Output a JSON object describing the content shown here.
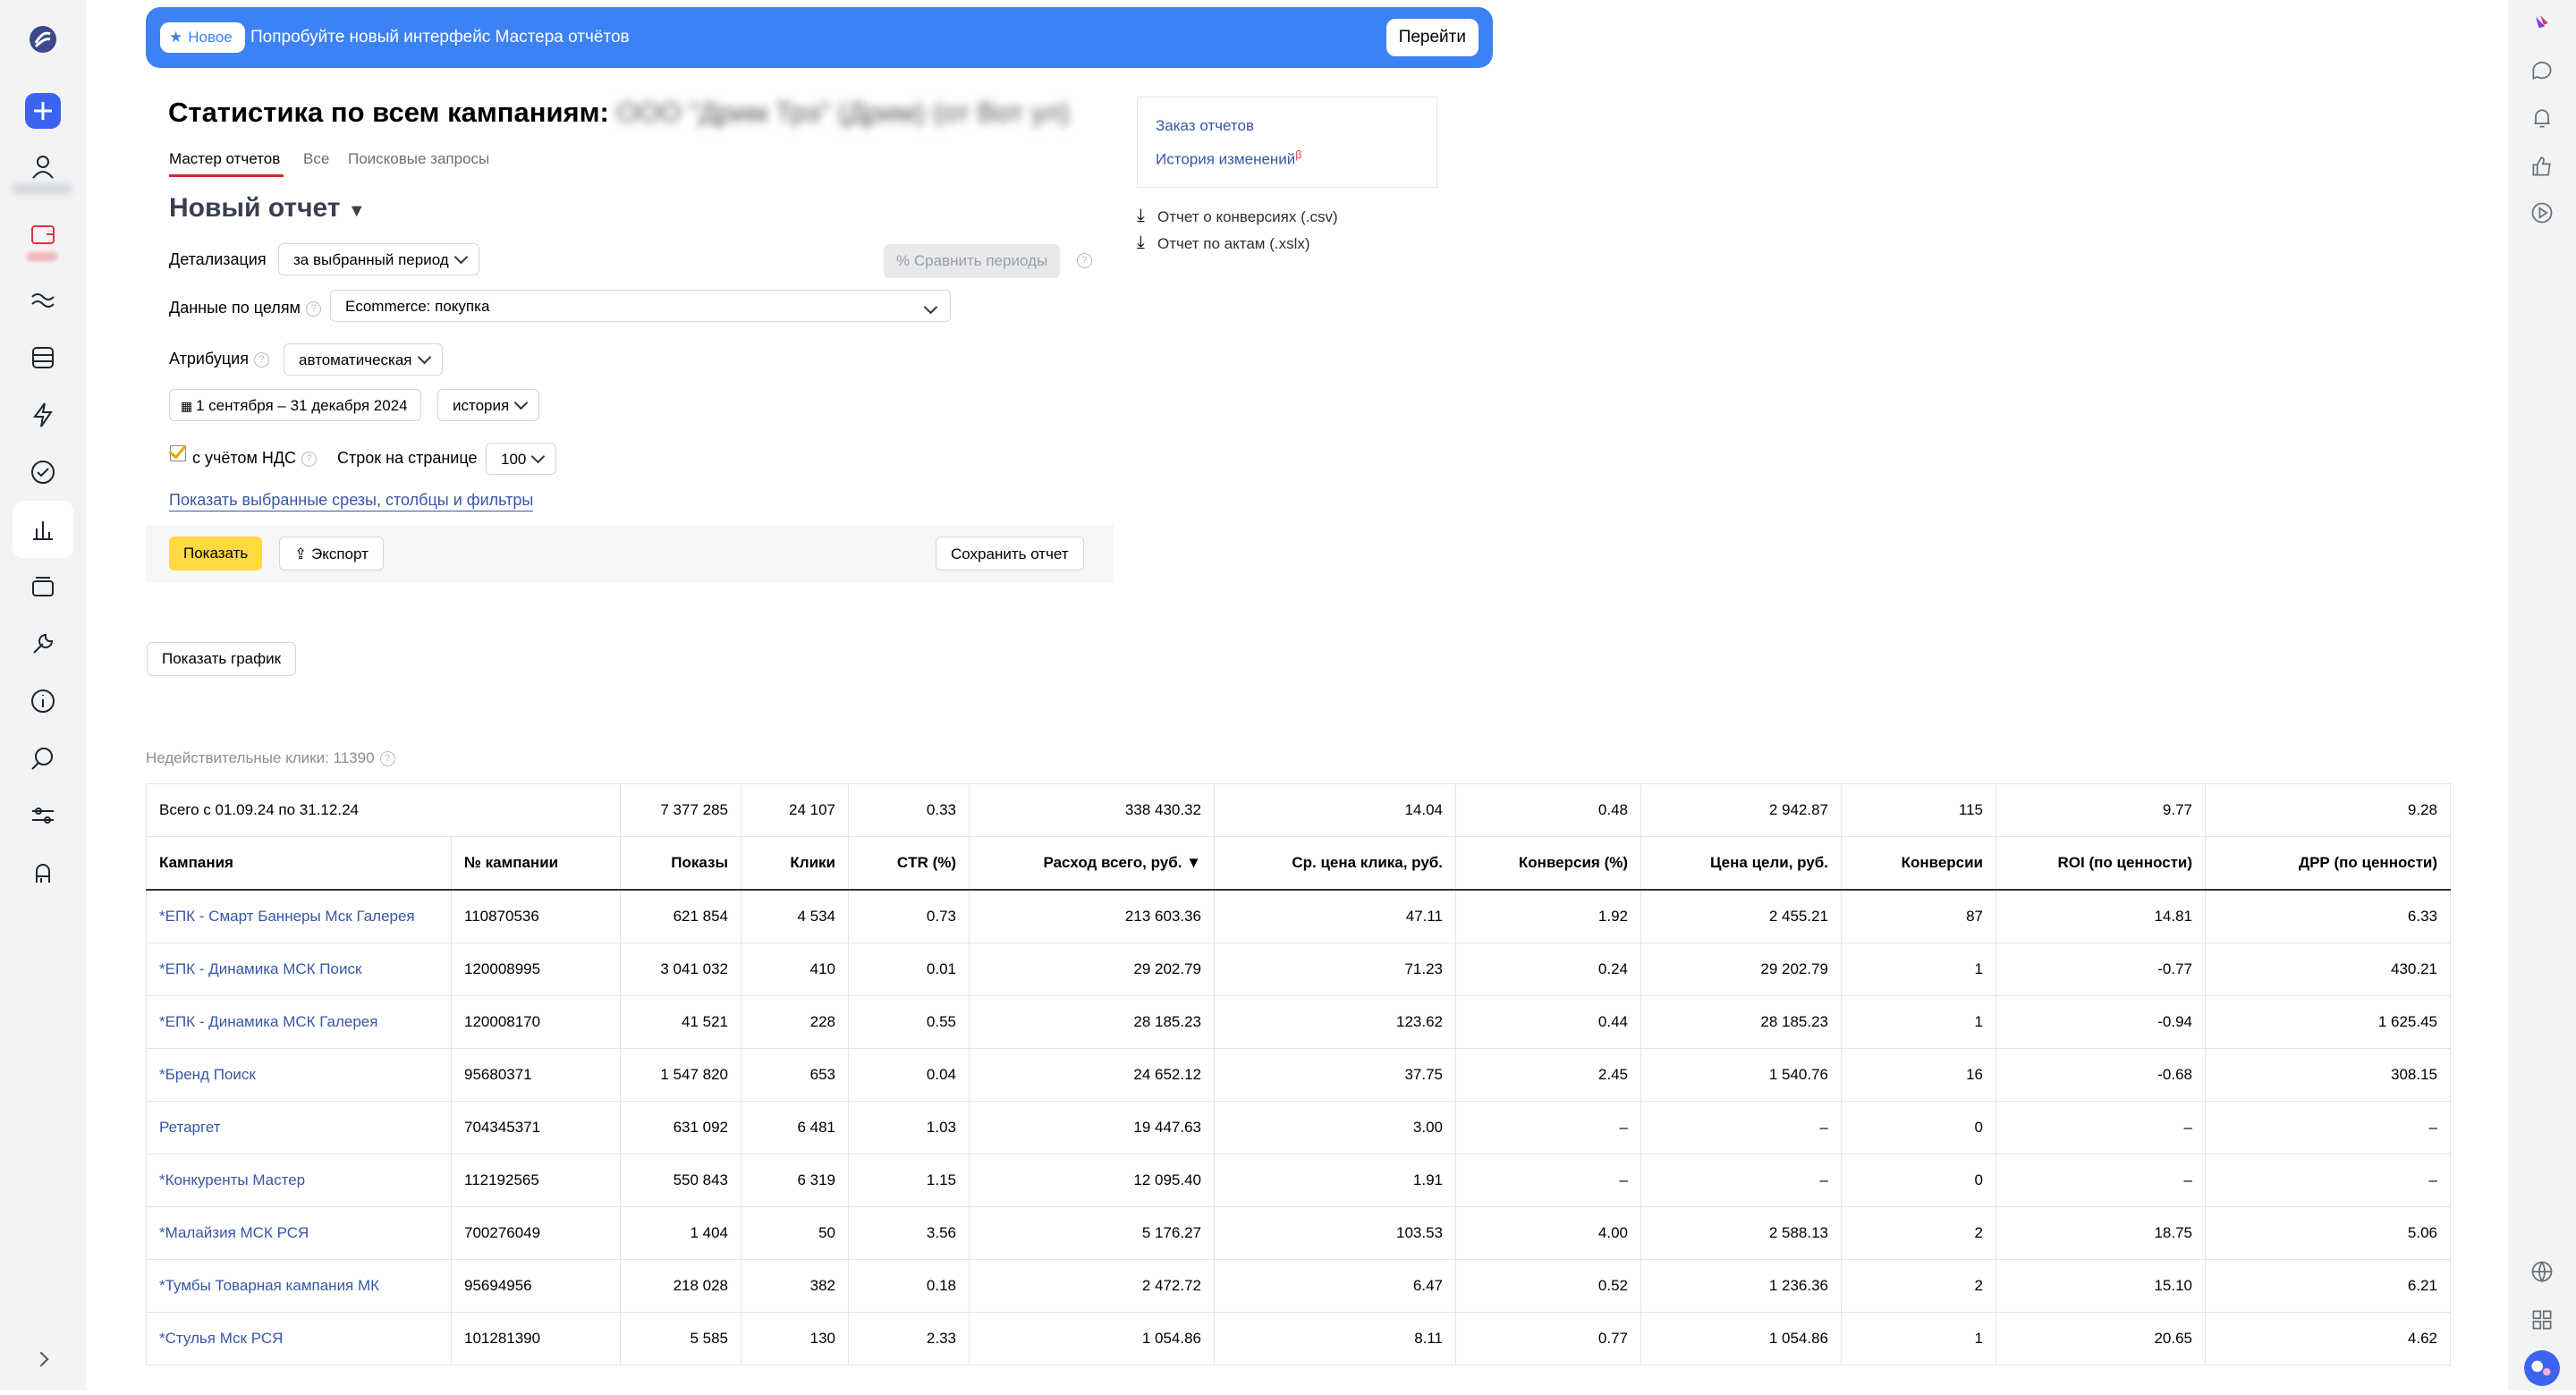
{
  "banner": {
    "badge": "Новое",
    "text": "Попробуйте новый интерфейс Мастера отчётов",
    "button": "Перейти"
  },
  "page": {
    "title": "Статистика по всем кампаниям:",
    "title_blurred": "ООО \"Дрим Трэ\" (Дрим) (от Вот ул)"
  },
  "tabs": [
    "Мастер отчетов",
    "Все",
    "Поисковые запросы"
  ],
  "report": {
    "name": "Новый отчет",
    "detail_label": "Детализация",
    "detail_value": "за выбранный период",
    "compare": "Сравнить периоды",
    "goals_label": "Данные по целям",
    "goals_value": "Ecommerce: покупка",
    "attribution_label": "Атрибуция",
    "attribution_value": "автоматическая",
    "date_range": "1 сентября – 31 декабря 2024",
    "history": "история",
    "vat_label": "с учётом НДС",
    "rows_label": "Строк на странице",
    "rows_value": "100",
    "filters_link": "Показать выбранные срезы, столбцы и фильтры",
    "show_button": "Показать",
    "export_button": "Экспорт",
    "save_button": "Сохранить отчет"
  },
  "side_links": {
    "order": "Заказ отчетов",
    "history": "История изменений",
    "history_sup": "β",
    "conversions": "Отчет о конверсиях (.csv)",
    "acts": "Отчет по актам (.xslx)"
  },
  "graph_button": "Показать график",
  "invalid_clicks": "Недействительные клики: 11390",
  "table": {
    "total": [
      "Всего с 01.09.24 по 31.12.24",
      "7 377 285",
      "24 107",
      "0.33",
      "338 430.32",
      "14.04",
      "0.48",
      "2 942.87",
      "115",
      "9.77",
      "9.28"
    ],
    "headers": [
      "Кампания",
      "№ кампании",
      "Показы",
      "Клики",
      "CTR (%)",
      "Расход всего, руб. ▼",
      "Ср. цена клика, руб.",
      "Конверсия (%)",
      "Цена цели, руб.",
      "Конверсии",
      "ROI (по ценности)",
      "ДРР (по ценности)"
    ],
    "rows": [
      [
        "*ЕПК - Смарт Баннеры Мск Галерея",
        "110870536",
        "621 854",
        "4 534",
        "0.73",
        "213 603.36",
        "47.11",
        "1.92",
        "2 455.21",
        "87",
        "14.81",
        "6.33"
      ],
      [
        "*ЕПК - Динамика МСК Поиск",
        "120008995",
        "3 041 032",
        "410",
        "0.01",
        "29 202.79",
        "71.23",
        "0.24",
        "29 202.79",
        "1",
        "-0.77",
        "430.21"
      ],
      [
        "*ЕПК - Динамика МСК Галерея",
        "120008170",
        "41 521",
        "228",
        "0.55",
        "28 185.23",
        "123.62",
        "0.44",
        "28 185.23",
        "1",
        "-0.94",
        "1 625.45"
      ],
      [
        "*Бренд Поиск",
        "95680371",
        "1 547 820",
        "653",
        "0.04",
        "24 652.12",
        "37.75",
        "2.45",
        "1 540.76",
        "16",
        "-0.68",
        "308.15"
      ],
      [
        "Ретаргет",
        "704345371",
        "631 092",
        "6 481",
        "1.03",
        "19 447.63",
        "3.00",
        "–",
        "–",
        "0",
        "–",
        "–"
      ],
      [
        "*Конкуренты Мастер",
        "112192565",
        "550 843",
        "6 319",
        "1.15",
        "12 095.40",
        "1.91",
        "–",
        "–",
        "0",
        "–",
        "–"
      ],
      [
        "*Малайзия МСК РСЯ",
        "700276049",
        "1 404",
        "50",
        "3.56",
        "5 176.27",
        "103.53",
        "4.00",
        "2 588.13",
        "2",
        "18.75",
        "5.06"
      ],
      [
        "*Тумбы Товарная кампания МК",
        "95694956",
        "218 028",
        "382",
        "0.18",
        "2 472.72",
        "6.47",
        "0.52",
        "1 236.36",
        "2",
        "15.10",
        "6.21"
      ],
      [
        "*Стулья Мск РСЯ",
        "101281390",
        "5 585",
        "130",
        "2.33",
        "1 054.86",
        "8.11",
        "0.77",
        "1 054.86",
        "1",
        "20.65",
        "4.62"
      ]
    ]
  }
}
